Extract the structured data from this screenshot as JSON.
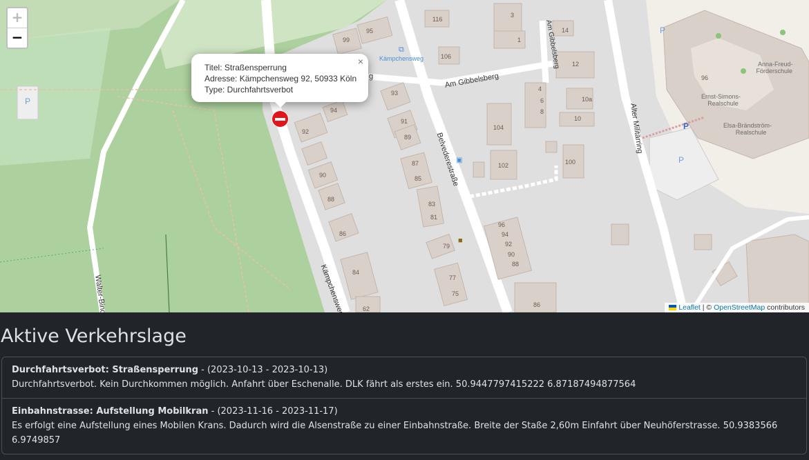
{
  "map": {
    "zoom_in_label": "+",
    "zoom_out_label": "−",
    "popup": {
      "close_label": "×",
      "title_line": "Titel: Straßensperrung",
      "address_line": "Adresse: Kämpchensweg 92, 50933 Köln",
      "type_line": "Type: Durchfahrtsverbot"
    },
    "attribution": {
      "leaflet": "Leaflet",
      "separator": " | © ",
      "osm": "OpenStreetMap",
      "contributors": " contributors"
    },
    "streets": {
      "kaempchensweg_top": "Kämpchensweg",
      "am_gibbelsberg": "Am Gibbelsberg",
      "am_gibbelsberg_v": "Am Gibbelsberg",
      "belvederestrasse": "Belvederestraße",
      "alter_militaerring": "Alter Militärring",
      "kaempchensweg": "Kämpchensweg",
      "walter_binder": "Walter-Bind",
      "g_label": "g"
    },
    "pois": {
      "ernst_simons": "Ernst-Simons-\nRealschule",
      "elsa": "Elsa-Brändström-\nRealschule",
      "anna_freud": "Anna-Freud-\nFörderschule",
      "ernst_simons_l1": "Ernst-Simons-",
      "ernst_simons_l2": "Realschule",
      "elsa_l1": "Elsa-Brändström-",
      "elsa_l2": "Realschule",
      "anna_l1": "Anna-Freud-",
      "anna_l2": "Förderschule"
    },
    "house_numbers": {
      "n116": "116",
      "n3": "3",
      "n14": "14",
      "n95": "95",
      "n99": "99",
      "n1": "1",
      "n106": "106",
      "n12": "12",
      "n93": "93",
      "n94": "94",
      "n4": "4",
      "n6": "6",
      "n8": "8",
      "n10a": "10a",
      "n10": "10",
      "n92": "92",
      "n91": "91",
      "n89": "89",
      "n104": "104",
      "n102": "102",
      "n100": "100",
      "n90": "90",
      "n87": "87",
      "n85": "85",
      "n88": "88",
      "n83": "83",
      "n81": "81",
      "n86": "86",
      "n96": "96",
      "n79": "79",
      "n84": "84",
      "n77": "77",
      "n75": "75",
      "n86b": "86",
      "h96": "96",
      "h94": "94",
      "h92": "92",
      "h90": "90",
      "h88": "88",
      "n62": "62"
    }
  },
  "section": {
    "heading": "Aktive Verkehrslage"
  },
  "incidents": [
    {
      "title": "Durchfahrtsverbot: Straßensperrung",
      "dates": " - (2023-10-13 - 2023-10-13)",
      "description": "Durchfahrtsverbot. Kein Durchkommen möglich. Anfahrt über Eschenalle. DLK fährt als erstes ein. 50.9447797415222 6.87187494877564"
    },
    {
      "title": "Einbahnstrasse: Aufstellung Mobilkran",
      "dates": " - (2023-11-16 - 2023-11-17)",
      "description": "Es erfolgt eine Aufstellung eines Mobilen Krans. Dadurch wird die Alsenstraße zu einer Einbahnstraße. Breite der Staße 2,60m Einfahrt über Neuhöferstrasse. 50.9383566 6.9749857"
    }
  ],
  "colors": {
    "forest": "#add19e",
    "park": "#c8facc",
    "road": "#ffffff",
    "building": "#d9d0c9",
    "background": "#212529",
    "marker": "#e3141b"
  }
}
